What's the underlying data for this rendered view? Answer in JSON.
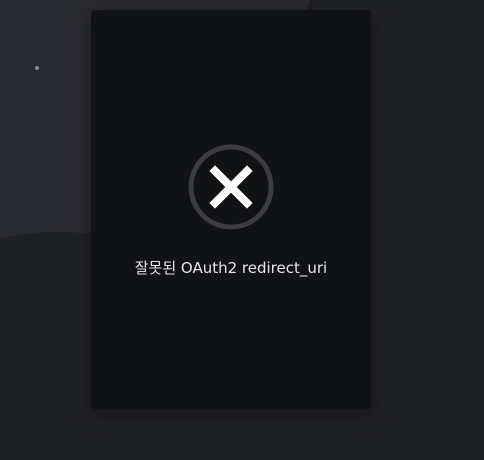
{
  "dialog": {
    "message": "잘못된 OAuth2 redirect_uri",
    "icon": "error-x-circle-icon"
  },
  "colors": {
    "background": "#202125",
    "background_light": "#2a2c31",
    "card": "#111214",
    "icon_ring": "#3c3d41",
    "icon_cross": "#ffffff",
    "text": "#e6e7e9"
  }
}
